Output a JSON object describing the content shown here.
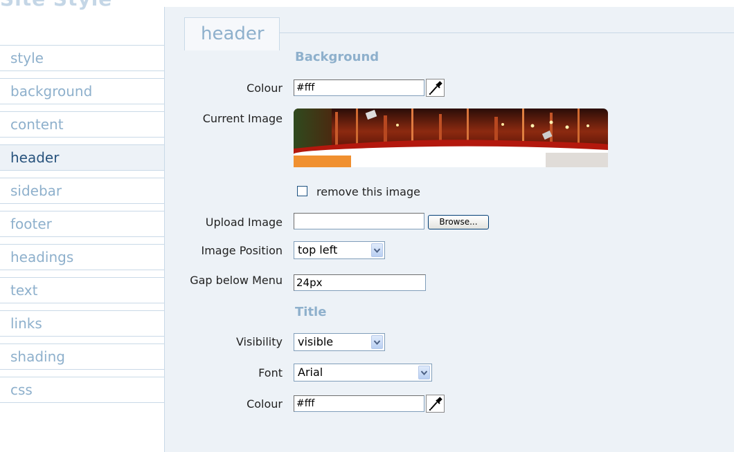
{
  "page": {
    "title": "Site Style"
  },
  "sidebar": {
    "items": [
      {
        "label": "style"
      },
      {
        "label": "background"
      },
      {
        "label": "content"
      },
      {
        "label": "header"
      },
      {
        "label": "sidebar"
      },
      {
        "label": "footer"
      },
      {
        "label": "headings"
      },
      {
        "label": "text"
      },
      {
        "label": "links"
      },
      {
        "label": "shading"
      },
      {
        "label": "css"
      }
    ],
    "active": "header"
  },
  "panel": {
    "tab_label": "header",
    "background": {
      "section_title": "Background",
      "colour_label": "Colour",
      "colour_value": "#fff",
      "current_image_label": "Current Image",
      "remove_image_label": "remove this image",
      "remove_image_checked": false,
      "upload_label": "Upload Image",
      "upload_value": "",
      "browse_label": "Browse...",
      "position_label": "Image Position",
      "position_value": "top left",
      "gap_label": "Gap below Menu",
      "gap_value": "24px"
    },
    "title": {
      "section_title": "Title",
      "visibility_label": "Visibility",
      "visibility_value": "visible",
      "font_label": "Font",
      "font_value": "Arial",
      "colour_label": "Colour",
      "colour_value": "#fff"
    }
  },
  "colors": {
    "accent": "#8eb0cc",
    "active_nav_text": "#28537d",
    "panel_bg": "#edf2f7",
    "border": "#c9d9e7"
  },
  "icons": {
    "colour_picker": "eyedropper-icon",
    "dropdown": "chevron-down-icon"
  }
}
